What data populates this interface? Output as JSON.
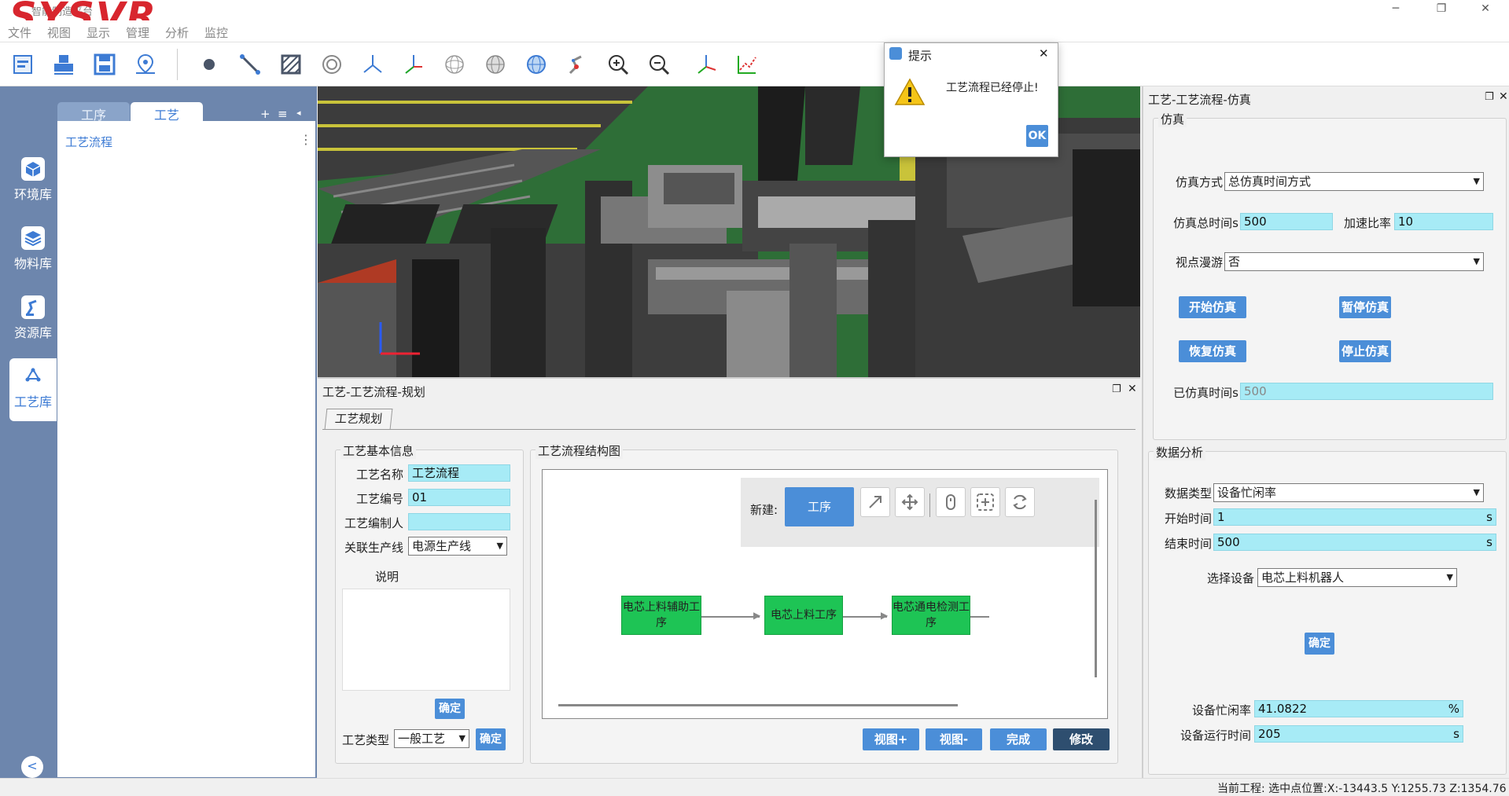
{
  "window": {
    "title": "智能制造平台",
    "logo": "SYSVR",
    "min": "─",
    "max": "❐",
    "close": "✕"
  },
  "menu": [
    "文件",
    "视图",
    "显示",
    "管理",
    "分析",
    "监控"
  ],
  "toolbar": {
    "icons": [
      "open-icon",
      "print-icon",
      "save-icon",
      "location-icon",
      "point-icon",
      "line-icon",
      "face-icon",
      "circle-icon",
      "axis-icon",
      "axis-alt-icon",
      "sphere-wire-icon",
      "sphere-grid-icon",
      "globe-icon",
      "robot-icon",
      "zoom-in-icon",
      "zoom-out-icon",
      "coordinate-icon",
      "chart-icon"
    ]
  },
  "rail": {
    "items": [
      {
        "label": "环境库"
      },
      {
        "label": "物料库"
      },
      {
        "label": "资源库"
      },
      {
        "label": "工艺库"
      }
    ],
    "collapse": "<"
  },
  "tree": {
    "tabs": [
      "工序",
      "工艺"
    ],
    "tools": [
      "+",
      "≡",
      "◂"
    ],
    "item": "工艺流程",
    "more": "⋮"
  },
  "plan": {
    "title": "工艺-工艺流程-规划",
    "tab": "工艺规划",
    "basic": {
      "title": "工艺基本信息",
      "name_label": "工艺名称",
      "name_value": "工艺流程",
      "code_label": "工艺编号",
      "code_value": "01",
      "author_label": "工艺编制人",
      "author_value": "",
      "line_label": "关联生产线",
      "line_value": "电源生产线",
      "desc_label": "说明",
      "confirm": "确定",
      "type_label": "工艺类型",
      "type_value": "一般工艺",
      "type_confirm": "确定"
    },
    "diagram": {
      "title": "工艺流程结构图",
      "new_label": "新建:",
      "process_btn": "工序",
      "nodes": [
        "电芯上料辅助工序",
        "电芯上料工序",
        "电芯通电检测工序"
      ],
      "buttons": {
        "view_plus": "视图+",
        "view_minus": "视图-",
        "done": "完成",
        "edit": "修改"
      }
    }
  },
  "sim": {
    "title": "工艺-工艺流程-仿真",
    "group_title": "仿真",
    "mode_label": "仿真方式",
    "mode_value": "总仿真时间方式",
    "total_label": "仿真总时间s",
    "total_value": "500",
    "speed_label": "加速比率",
    "speed_value": "10",
    "roam_label": "视点漫游",
    "roam_value": "否",
    "start": "开始仿真",
    "pause": "暂停仿真",
    "resume": "恢复仿真",
    "stop": "停止仿真",
    "elapsed_label": "已仿真时间s",
    "elapsed_value": "500"
  },
  "analysis": {
    "title": "数据分析",
    "type_label": "数据类型",
    "type_value": "设备忙闲率",
    "start_label": "开始时间",
    "start_value": "1",
    "start_unit": "s",
    "end_label": "结束时间",
    "end_value": "500",
    "end_unit": "s",
    "device_label": "选择设备",
    "device_value": "电芯上料机器人",
    "confirm": "确定",
    "busy_label": "设备忙闲率",
    "busy_value": "41.0822",
    "busy_unit": "%",
    "run_label": "设备运行时间",
    "run_value": "205",
    "run_unit": "s"
  },
  "dialog": {
    "title": "提示",
    "message": "工艺流程已经停止!",
    "ok": "OK",
    "close": "✕"
  },
  "status": {
    "text": "当前工程:  选中点位置:X:-13443.5 Y:1255.73 Z:1354.76"
  },
  "colors": {
    "accent": "#4b8ed8",
    "rail": "#6d86ad",
    "field": "#a7ebf6",
    "node": "#1ec455",
    "brand": "#d8262e"
  }
}
